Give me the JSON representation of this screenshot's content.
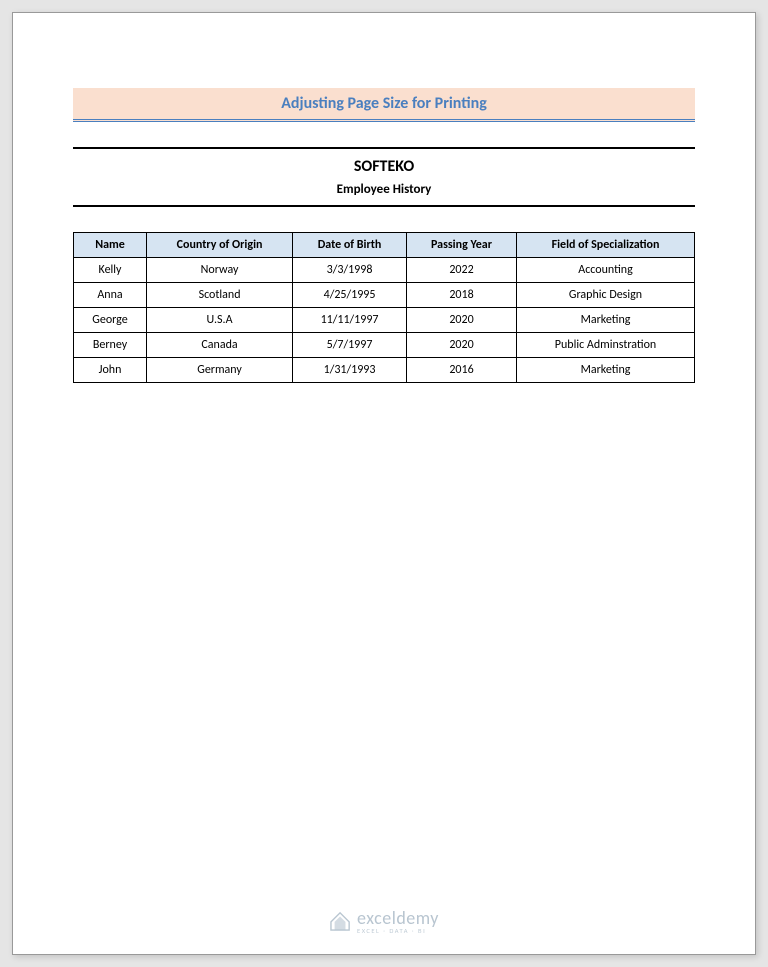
{
  "banner": {
    "title": "Adjusting Page Size for Printing"
  },
  "heading": {
    "company": "SOFTEKO",
    "subtitle": "Employee History"
  },
  "table": {
    "headers": [
      "Name",
      "Country of Origin",
      "Date of Birth",
      "Passing Year",
      "Field of Specialization"
    ],
    "rows": [
      [
        "Kelly",
        "Norway",
        "3/3/1998",
        "2022",
        "Accounting"
      ],
      [
        "Anna",
        "Scotland",
        "4/25/1995",
        "2018",
        "Graphic Design"
      ],
      [
        "George",
        "U.S.A",
        "11/11/1997",
        "2020",
        "Marketing"
      ],
      [
        "Berney",
        "Canada",
        "5/7/1997",
        "2020",
        "Public Adminstration"
      ],
      [
        "John",
        "Germany",
        "1/31/1993",
        "2016",
        "Marketing"
      ]
    ]
  },
  "watermark": {
    "brand": "exceldemy",
    "tagline": "EXCEL · DATA · BI"
  }
}
